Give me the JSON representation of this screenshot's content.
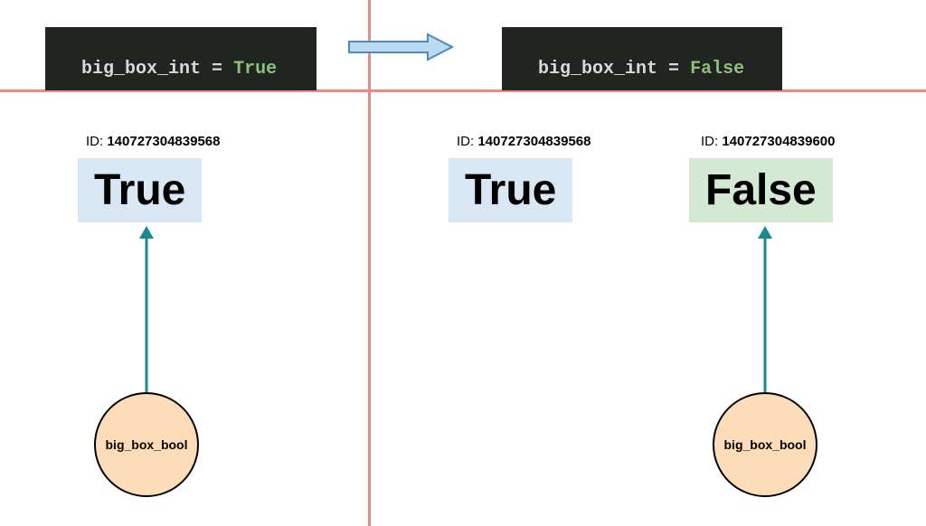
{
  "left_code": {
    "var": "big_box_int",
    "op": " = ",
    "value": "True"
  },
  "right_code": {
    "var": "big_box_int",
    "op": " = ",
    "value": "False"
  },
  "id_prefix": "ID: ",
  "left_true": {
    "id": "140727304839568",
    "value": "True",
    "pointer_label": "big_box_bool"
  },
  "right_true": {
    "id": "140727304839568",
    "value": "True"
  },
  "right_false": {
    "id": "140727304839600",
    "value": "False",
    "pointer_label": "big_box_bool"
  },
  "colors": {
    "divider": "#e88b87",
    "code_bg": "#202521",
    "true_box": "#d9e7f5",
    "false_box": "#d3e9d3",
    "circle": "#fdddb9",
    "arrow": "#1a8b8b",
    "right_arrow_fill": "#b9daef",
    "right_arrow_stroke": "#4a8cc2"
  }
}
